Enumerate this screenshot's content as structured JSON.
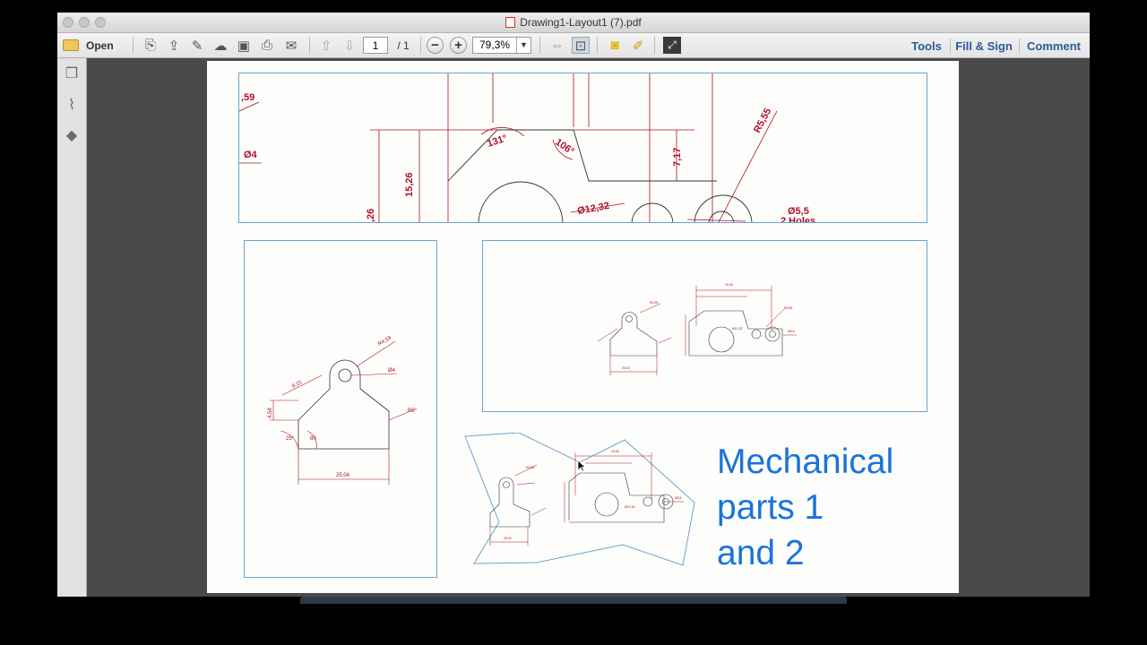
{
  "window": {
    "title": "Drawing1-Layout1 (7).pdf"
  },
  "toolbar": {
    "open_label": "Open",
    "page_current": "1",
    "page_total": "/ 1",
    "zoom": "79,3%",
    "tools_label": "Tools",
    "fill_sign_label": "Fill & Sign",
    "comment_label": "Comment"
  },
  "drawing": {
    "top_view": {
      "dims": [
        ",59",
        "Ø4",
        "131°",
        "106°",
        "15,26",
        "7,17",
        "R5,55",
        "Ø12,32",
        "Ø5,5",
        "2 Holes",
        ",26"
      ]
    },
    "left_view": {
      "dims": [
        "R4,59",
        "Ø4",
        "6,15",
        "4,58",
        "R5",
        "25,04",
        "25°",
        "80"
      ]
    },
    "caption": {
      "line1": "Mechanical",
      "line2": "parts 1",
      "line3": "and 2"
    }
  }
}
